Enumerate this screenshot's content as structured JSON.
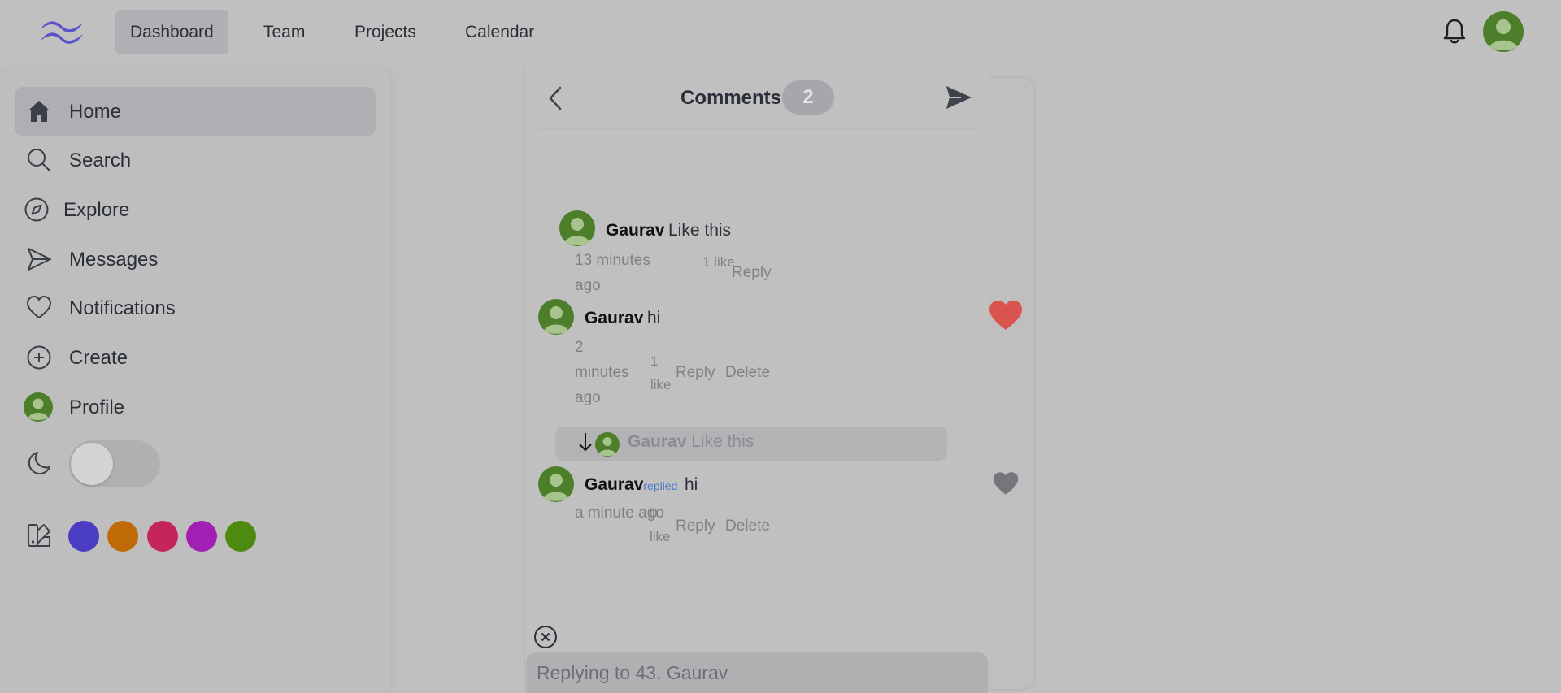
{
  "topnav": {
    "tabs": [
      "Dashboard",
      "Team",
      "Projects",
      "Calendar"
    ],
    "active_tab": "Dashboard"
  },
  "sidebar": {
    "items": [
      {
        "label": "Home",
        "icon": "home-icon"
      },
      {
        "label": "Search",
        "icon": "search-icon"
      },
      {
        "label": "Explore",
        "icon": "compass-icon"
      },
      {
        "label": "Messages",
        "icon": "send-icon"
      },
      {
        "label": "Notifications",
        "icon": "heart-icon"
      },
      {
        "label": "Create",
        "icon": "plus-circle-icon"
      },
      {
        "label": "Profile",
        "icon": "avatar"
      }
    ],
    "active_item": "Home",
    "dark_mode_on": false,
    "theme_colors": [
      "#4b3cc4",
      "#bf6a06",
      "#c6245d",
      "#a11fb3",
      "#4f8a10"
    ]
  },
  "comments": {
    "title": "Comments",
    "count": "2",
    "items": [
      {
        "author": "Gaurav",
        "text": "Like this",
        "time": "13 minutes ago",
        "likes": "1 like",
        "actions": [
          "Reply"
        ]
      },
      {
        "author": "Gaurav",
        "text": "hi",
        "time": "2 minutes ago",
        "likes": "1 like",
        "actions": [
          "Reply",
          "Delete"
        ],
        "liked": true
      },
      {
        "author": "Gaurav",
        "replied_label": "replied",
        "text": "hi",
        "time": "a minute ago",
        "likes": "0 like",
        "actions": [
          "Reply",
          "Delete"
        ],
        "liked": false
      }
    ],
    "reply_preview": {
      "author": "Gaurav",
      "text": "Like this"
    },
    "reply_input_placeholder": "Replying to 43. Gaurav"
  },
  "colors": {
    "like_active": "#d9534f",
    "like_inactive": "#74767c",
    "accent": "#4f46e5"
  }
}
